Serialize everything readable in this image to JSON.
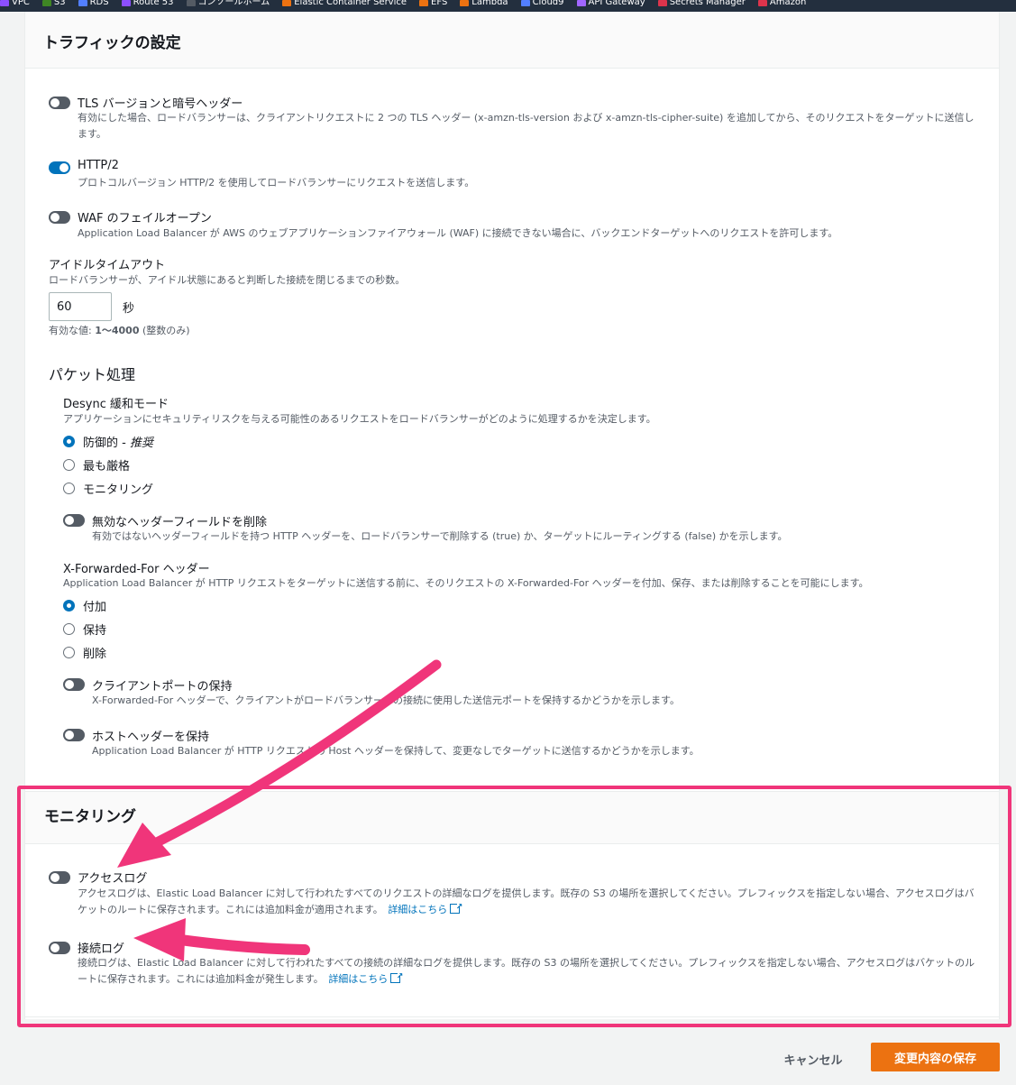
{
  "bookmarks": [
    {
      "label": "VPC",
      "color": "#8c4fff"
    },
    {
      "label": "S3",
      "color": "#3f8624"
    },
    {
      "label": "RDS",
      "color": "#527fff"
    },
    {
      "label": "Route 53",
      "color": "#8c4fff"
    },
    {
      "label": "コンソールホーム",
      "color": "#545b64"
    },
    {
      "label": "Elastic Container Service",
      "color": "#ec7211"
    },
    {
      "label": "EFS",
      "color": "#ec7211"
    },
    {
      "label": "Lambda",
      "color": "#ec7211"
    },
    {
      "label": "Cloud9",
      "color": "#527fff"
    },
    {
      "label": "API Gateway",
      "color": "#a166ff"
    },
    {
      "label": "Secrets Manager",
      "color": "#dd344c"
    },
    {
      "label": "Amazon",
      "color": "#dd344c"
    }
  ],
  "traffic": {
    "title": "トラフィックの設定",
    "tls": {
      "label": "TLS バージョンと暗号ヘッダー",
      "desc": "有効にした場合、ロードバランサーは、クライアントリクエストに 2 つの TLS ヘッダー (x-amzn-tls-version および x-amzn-tls-cipher-suite) を追加してから、そのリクエストをターゲットに送信します。",
      "enabled": false
    },
    "http2": {
      "label": "HTTP/2",
      "desc": "プロトコルバージョン HTTP/2 を使用してロードバランサーにリクエストを送信します。",
      "enabled": true
    },
    "waf": {
      "label": "WAF のフェイルオープン",
      "desc": "Application Load Balancer が AWS のウェブアプリケーションファイアウォール (WAF) に接続できない場合に、バックエンドターゲットへのリクエストを許可します。",
      "enabled": false
    },
    "idle": {
      "label": "アイドルタイムアウト",
      "desc": "ロードバランサーが、アイドル状態にあると判断した接続を閉じるまでの秒数。",
      "value": "60",
      "unit": "秒",
      "hint_prefix": "有効な値: ",
      "hint_range": "1〜4000",
      "hint_suffix": " (整数のみ)"
    }
  },
  "packet": {
    "title": "パケット処理",
    "desync": {
      "label": "Desync 緩和モード",
      "desc": "アプリケーションにセキュリティリスクを与える可能性のあるリクエストをロードバランサーがどのように処理するかを決定します。",
      "options": [
        "防御的 - ",
        "最も厳格",
        "モニタリング"
      ],
      "recommended": "推奨",
      "selected": 0
    },
    "drop_invalid": {
      "label": "無効なヘッダーフィールドを削除",
      "desc": "有効ではないヘッダーフィールドを持つ HTTP ヘッダーを、ロードバランサーで削除する (true) か、ターゲットにルーティングする (false) かを示します。",
      "enabled": false
    },
    "xff": {
      "label": "X-Forwarded-For ヘッダー",
      "desc": "Application Load Balancer が HTTP リクエストをターゲットに送信する前に、そのリクエストの X-Forwarded-For ヘッダーを付加、保存、または削除することを可能にします。",
      "options": [
        "付加",
        "保持",
        "削除"
      ],
      "selected": 0
    },
    "client_port": {
      "label": "クライアントポートの保持",
      "desc": "X-Forwarded-For ヘッダーで、クライアントがロードバランサーへの接続に使用した送信元ポートを保持するかどうかを示します。",
      "enabled": false
    },
    "host_header": {
      "label": "ホストヘッダーを保持",
      "desc": "Application Load Balancer が HTTP リクエストの Host ヘッダーを保持して、変更なしでターゲットに送信するかどうかを示します。",
      "enabled": false
    }
  },
  "monitoring": {
    "title": "モニタリング",
    "access_log": {
      "label": "アクセスログ",
      "desc": "アクセスログは、Elastic Load Balancer に対して行われたすべてのリクエストの詳細なログを提供します。既存の S3 の場所を選択してください。プレフィックスを指定しない場合、アクセスログはバケットのルートに保存されます。これには追加料金が適用されます。",
      "link": "詳細はこちら",
      "enabled": false
    },
    "connection_log": {
      "label": "接続ログ",
      "desc": "接続ログは、Elastic Load Balancer に対して行われたすべての接続の詳細なログを提供します。既存の S3 の場所を選択してください。プレフィックスを指定しない場合、アクセスログはバケットのルートに保存されます。これには追加料金が発生します。",
      "link": "詳細はこちら",
      "enabled": false
    }
  },
  "footer": {
    "cancel": "キャンセル",
    "save": "変更内容の保存"
  },
  "colors": {
    "accent": "#0073bb",
    "primary_button": "#ec7211",
    "highlight": "#f0357a"
  }
}
